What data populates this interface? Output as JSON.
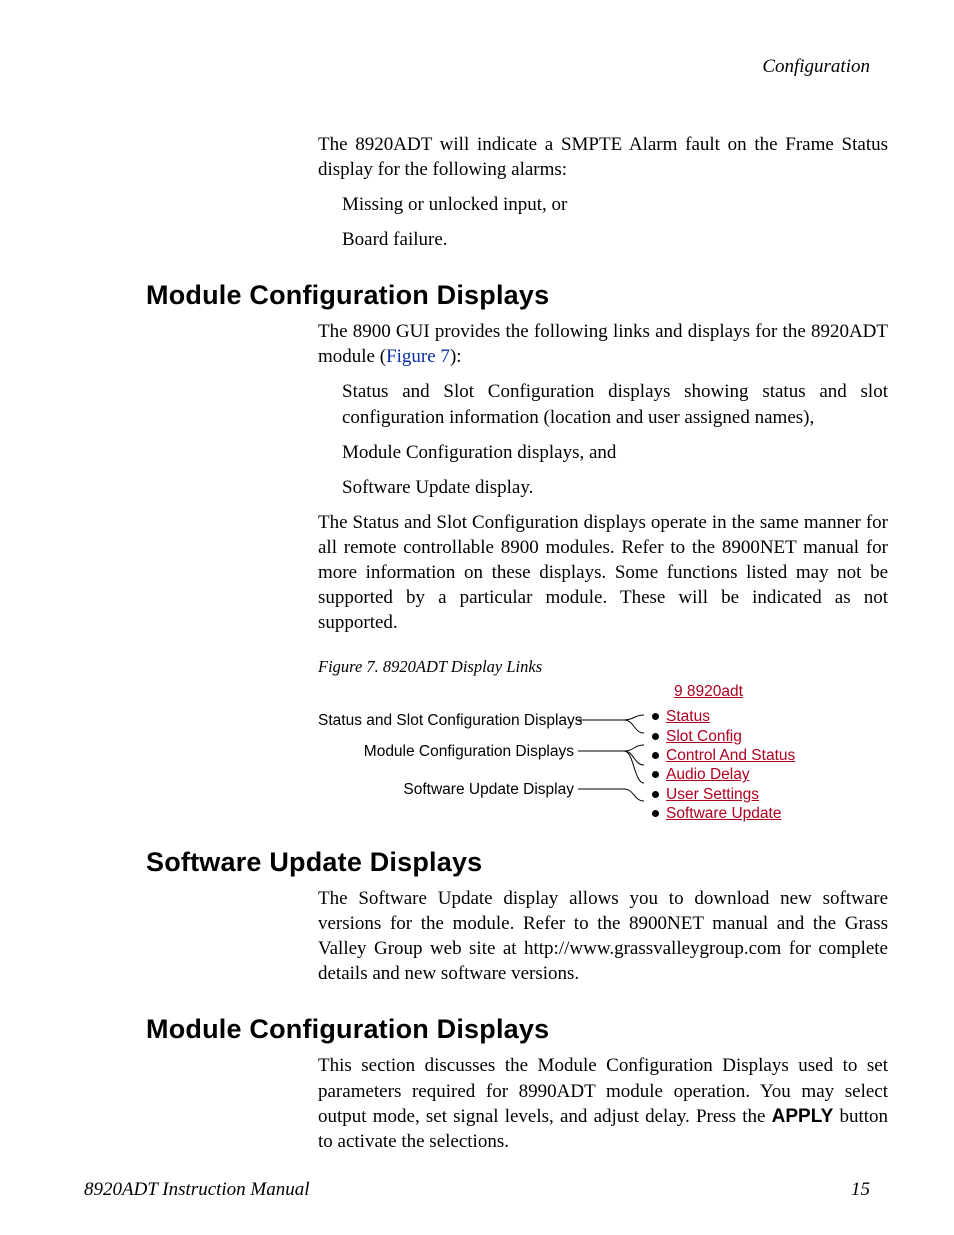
{
  "header": {
    "section": "Configuration"
  },
  "intro": {
    "p1": "The 8920ADT will indicate a SMPTE Alarm fault on the Frame Status display for the following alarms:",
    "b1": "Missing or unlocked input, or",
    "b2": "Board failure."
  },
  "sec1": {
    "title": "Module Configuration Displays",
    "p1a": "The 8900 GUI provides the following links and displays for the 8920ADT module (",
    "figref": "Figure 7",
    "p1b": "):",
    "b1": "Status and Slot Configuration displays showing status and slot configuration information (location and user assigned names),",
    "b2": "Module Configuration displays, and",
    "b3": "Software Update display.",
    "p2": "The Status and Slot Configuration displays operate in the same manner for all remote controllable 8900 modules. Refer to the 8900NET manual for more information on these displays. Some functions listed may not be supported by a particular module. These will be indicated as not supported."
  },
  "figure": {
    "caption": "Figure 7.  8920ADT Display Links",
    "label1": "Status and Slot Configuration Displays",
    "label2": "Module Configuration Displays",
    "label3": "Software Update Display",
    "link_title": "9 8920adt",
    "links": {
      "l1": "Status",
      "l2": "Slot Config",
      "l3": "Control And Status",
      "l4": "Audio Delay",
      "l5": "User Settings",
      "l6": "Software Update"
    }
  },
  "sec2": {
    "title": "Software Update Displays",
    "p1": "The Software Update display allows you to download new software versions for the module. Refer to the 8900NET manual and the Grass Valley Group web site at http://www.grassvalleygroup.com for complete details and new software versions."
  },
  "sec3": {
    "title": "Module Configuration Displays",
    "p1a": "This section discusses the Module Configuration Displays used to set parameters required for 8990ADT module operation. You may select output mode, set signal levels, and adjust delay. Press the ",
    "apply": "APPLY",
    "p1b": " button to activate the selections."
  },
  "footer": {
    "left": "8920ADT Instruction Manual",
    "right": "15"
  }
}
